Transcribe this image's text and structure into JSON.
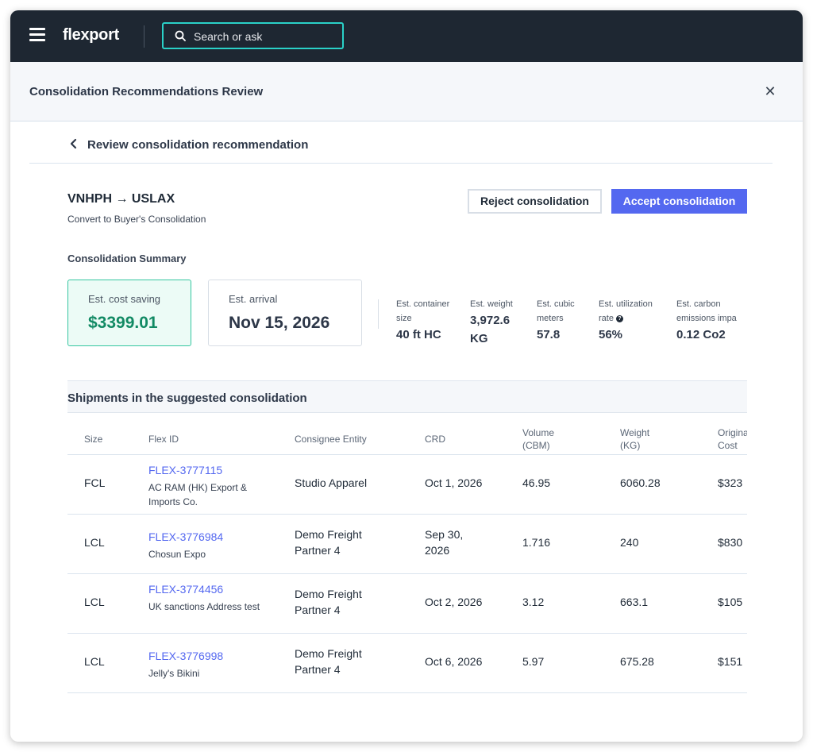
{
  "topbar": {
    "logo": "flexport",
    "search_placeholder": "Search or ask"
  },
  "panel": {
    "title": "Consolidation Recommendations Review"
  },
  "back": {
    "title": "Review consolidation recommendation"
  },
  "route": {
    "title": "VNHPH → USLAX",
    "subtitle": "Convert to Buyer's Consolidation"
  },
  "actions": {
    "reject": "Reject consolidation",
    "accept": "Accept consolidation"
  },
  "summary": {
    "title": "Consolidation Summary",
    "cost_saving": {
      "label": "Est. cost saving",
      "value": "$3399.01"
    },
    "arrival": {
      "label": "Est. arrival",
      "value": "Nov 15, 2026"
    },
    "metrics": [
      {
        "label": "Est. container size",
        "value": "40 ft HC"
      },
      {
        "label": "Est. weight",
        "value": "3,972.6 KG"
      },
      {
        "label": "Est. cubic meters",
        "value": "57.8"
      },
      {
        "label": "Est. utilization rate",
        "value": "56%"
      },
      {
        "label": "Est. carbon emissions impa",
        "value": "0.12 Co2"
      }
    ]
  },
  "shipments": {
    "title": "Shipments in the suggested consolidation",
    "columns": [
      "Size",
      "Flex ID",
      "Consignee Entity",
      "CRD",
      "Volume (CBM)",
      "Weight (KG)",
      "Origina Cost"
    ],
    "rows": [
      {
        "size": "FCL",
        "flex_id": "FLEX-3777115",
        "shipper": "AC RAM (HK) Export & Imports Co.",
        "consignee": "Studio Apparel",
        "crd": "Oct 1, 2026",
        "volume": "46.95",
        "weight": "6060.28",
        "cost": "$323"
      },
      {
        "size": "LCL",
        "flex_id": "FLEX-3776984",
        "shipper": "Chosun Expo",
        "consignee": "Demo Freight Partner 4",
        "crd": "Sep 30, 2026",
        "volume": "1.716",
        "weight": "240",
        "cost": "$830"
      },
      {
        "size": "LCL",
        "flex_id": "FLEX-3774456",
        "shipper": "UK sanctions Address test",
        "consignee": "Demo Freight Partner 4",
        "crd": "Oct 2, 2026",
        "volume": "3.12",
        "weight": "663.1",
        "cost": "$105"
      },
      {
        "size": "LCL",
        "flex_id": "FLEX-3776998",
        "shipper": "Jelly's Bikini",
        "consignee": "Demo Freight Partner 4",
        "crd": "Oct 6, 2026",
        "volume": "5.97",
        "weight": "675.28",
        "cost": "$151"
      }
    ]
  }
}
